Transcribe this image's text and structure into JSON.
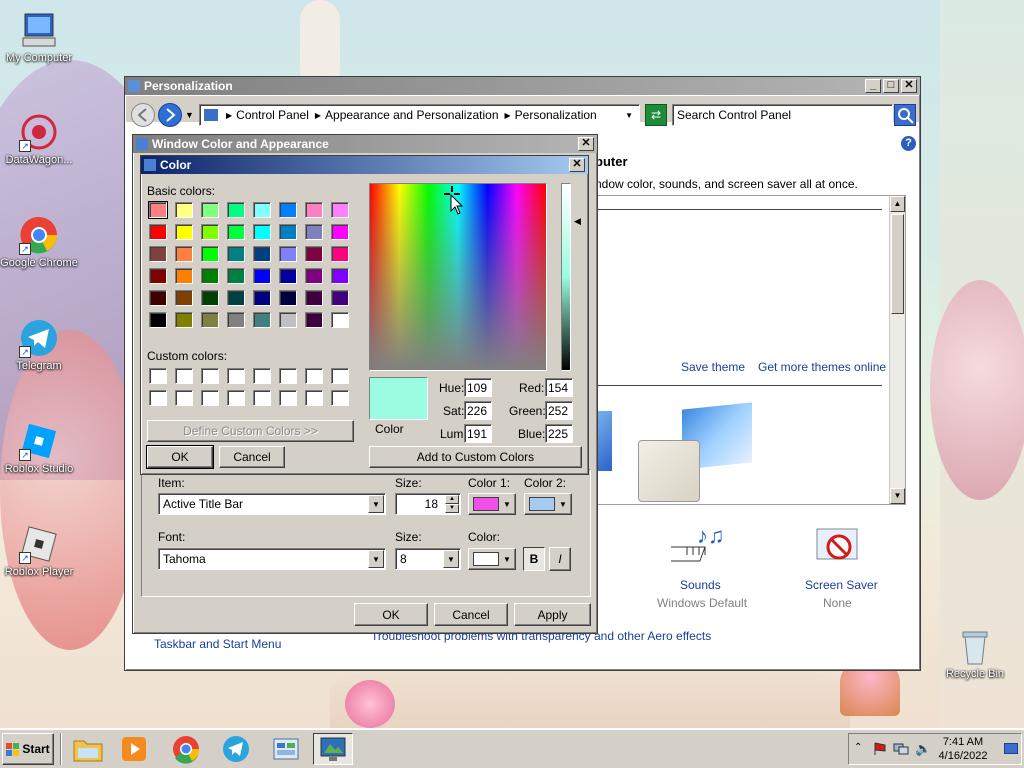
{
  "desktop": {
    "icons": [
      {
        "label": "My Computer"
      },
      {
        "label": "DataWagon..."
      },
      {
        "label": "Google Chrome"
      },
      {
        "label": "Telegram"
      },
      {
        "label": "Roblox Studio"
      },
      {
        "label": "Roblox Player"
      },
      {
        "label": "Recycle Bin"
      }
    ]
  },
  "personalization": {
    "title": "Personalization",
    "breadcrumb": [
      "Control Panel",
      "Appearance and Personalization",
      "Personalization"
    ],
    "search_placeholder": "Search Control Panel",
    "heading_partial": "puter",
    "subtitle_partial": "ndow color, sounds, and screen saver all at once.",
    "save_theme": "Save theme",
    "more_themes": "Get more themes online",
    "sounds_label": "Sounds",
    "sounds_value": "Windows Default",
    "screensaver_label": "Screen Saver",
    "screensaver_value": "None",
    "taskbar_link": "Taskbar and Start Menu",
    "troubleshoot_link": "Troubleshoot problems with transparency and other Aero effects"
  },
  "wca": {
    "title": "Window Color and Appearance",
    "item_label": "Item:",
    "item_value": "Active Title Bar",
    "size_label": "Size:",
    "size_value": "18",
    "color1_label": "Color 1:",
    "color2_label": "Color 2:",
    "color1": "#f050e8",
    "color2": "#a6caf0",
    "font_label": "Font:",
    "font_value": "Tahoma",
    "font_size_label": "Size:",
    "font_size_value": "8",
    "font_color_label": "Color:",
    "font_color": "#ffffff",
    "bold_label": "B",
    "italic_label": "I",
    "ok": "OK",
    "cancel": "Cancel",
    "apply": "Apply"
  },
  "color_dialog": {
    "title": "Color",
    "basic_colors_label": "Basic colors:",
    "custom_colors_label": "Custom colors:",
    "define_custom": "Define Custom Colors >>",
    "ok": "OK",
    "cancel": "Cancel",
    "add_custom": "Add to Custom Colors",
    "color_label": "Color",
    "preview_color": "#9afce1",
    "hue_label": "Hue:",
    "hue": "109",
    "sat_label": "Sat:",
    "sat": "226",
    "lum_label": "Lum:",
    "lum": "191",
    "red_label": "Red:",
    "red": "154",
    "green_label": "Green:",
    "green": "252",
    "blue_label": "Blue:",
    "blue": "225",
    "basic_colors": [
      "#ff8080",
      "#ffff80",
      "#80ff80",
      "#00ff80",
      "#80ffff",
      "#0080ff",
      "#ff80c0",
      "#ff80ff",
      "#ff0000",
      "#ffff00",
      "#80ff00",
      "#00ff40",
      "#00ffff",
      "#0080c0",
      "#8080c0",
      "#ff00ff",
      "#804040",
      "#ff8040",
      "#00ff00",
      "#008080",
      "#004080",
      "#8080ff",
      "#800040",
      "#ff0080",
      "#800000",
      "#ff8000",
      "#008000",
      "#008040",
      "#0000ff",
      "#0000a0",
      "#800080",
      "#8000ff",
      "#400000",
      "#804000",
      "#004000",
      "#004040",
      "#000080",
      "#000040",
      "#400040",
      "#400080",
      "#000000",
      "#808000",
      "#808040",
      "#808080",
      "#408080",
      "#c0c0c0",
      "#400040",
      "#ffffff"
    ]
  },
  "taskbar": {
    "start": "Start",
    "time": "7:41 AM",
    "date": "4/16/2022"
  }
}
